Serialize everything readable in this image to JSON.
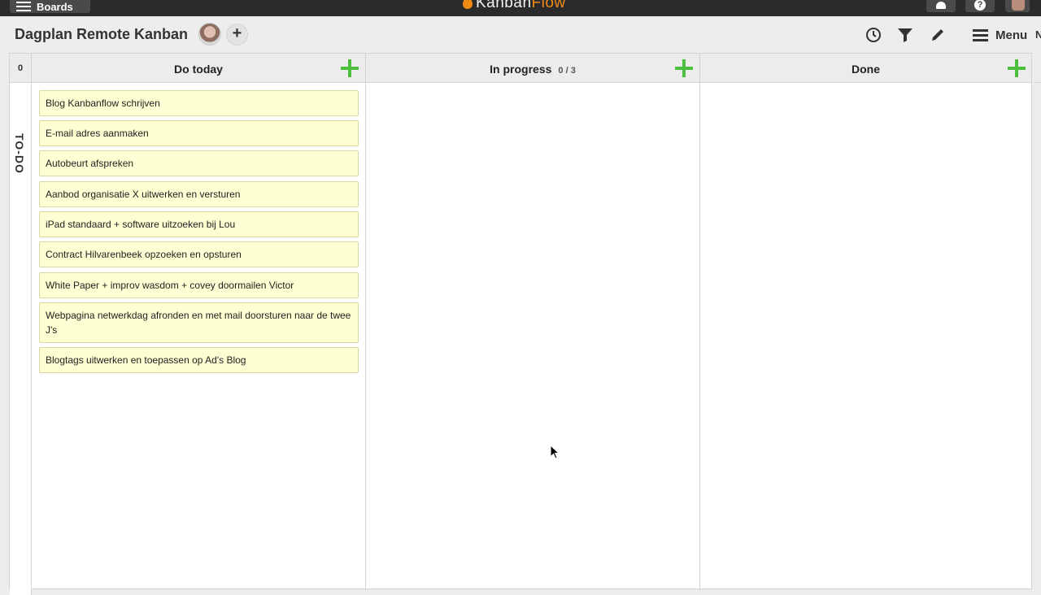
{
  "topbar": {
    "boards_label": "Boards",
    "logo_part1": "Kanban",
    "logo_part2": "Flow",
    "help_label": "?"
  },
  "header": {
    "board_title": "Dagplan Remote Kanban",
    "add_user_label": "+",
    "menu_label": "Menu",
    "clipped_text": "N"
  },
  "swimlane": {
    "count": "0",
    "label": "TO-DO"
  },
  "columns": [
    {
      "title": "Do today",
      "wip": "",
      "cards": [
        "Blog Kanbanflow schrijven",
        "E-mail adres aanmaken",
        "Autobeurt afspreken",
        "Aanbod organisatie X uitwerken en versturen",
        "iPad standaard + software uitzoeken bij Lou",
        "Contract Hilvarenbeek opzoeken en opsturen",
        "White Paper + improv wasdom + covey doormailen Victor",
        "Webpagina netwerkdag afronden en met mail doorsturen naar de twee J's",
        "Blogtags uitwerken en toepassen op Ad's Blog"
      ]
    },
    {
      "title": "In progress",
      "wip": "0 / 3",
      "cards": []
    },
    {
      "title": "Done",
      "wip": "",
      "cards": []
    }
  ],
  "colors": {
    "card_bg": "#ffffd4",
    "add_green": "#4cbf3f",
    "logo_orange": "#f28b13",
    "topbar": "#2b2b2b"
  }
}
